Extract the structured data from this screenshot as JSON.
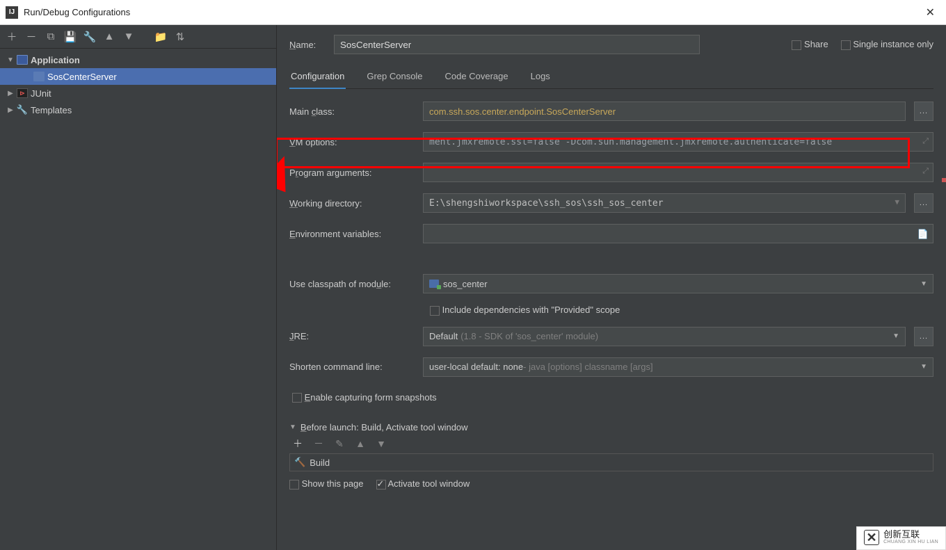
{
  "window": {
    "title": "Run/Debug Configurations"
  },
  "sidebar": {
    "items": [
      {
        "label": "Application",
        "kind": "folder",
        "expanded": true
      },
      {
        "label": "SosCenterServer",
        "kind": "item",
        "selected": true
      },
      {
        "label": "JUnit",
        "kind": "folder",
        "expanded": false
      },
      {
        "label": "Templates",
        "kind": "folder",
        "expanded": false
      }
    ]
  },
  "header": {
    "name_label": "Name:",
    "name_value": "SosCenterServer",
    "share_label": "Share",
    "single_instance_label": "Single instance only"
  },
  "tabs": [
    {
      "label": "Configuration",
      "active": true
    },
    {
      "label": "Grep Console"
    },
    {
      "label": "Code Coverage"
    },
    {
      "label": "Logs"
    }
  ],
  "form": {
    "main_class_label": "Main class:",
    "main_class_value": "com.ssh.sos.center.endpoint.SosCenterServer",
    "vm_options_label": "VM options:",
    "vm_options_value": "ment.jmxremote.ssl=false -Dcom.sun.management.jmxremote.authenticate=false",
    "program_args_label": "Program arguments:",
    "program_args_value": "",
    "working_dir_label": "Working directory:",
    "working_dir_value": "E:\\shengshiworkspace\\ssh_sos\\ssh_sos_center",
    "env_vars_label": "Environment variables:",
    "env_vars_value": "",
    "classpath_label": "Use classpath of module:",
    "classpath_value": "sos_center",
    "include_provided_label": "Include dependencies with \"Provided\" scope",
    "jre_label": "JRE:",
    "jre_value": "Default",
    "jre_hint": "(1.8 - SDK of 'sos_center' module)",
    "shorten_label": "Shorten command line:",
    "shorten_value": "user-local default: none",
    "shorten_hint": " - java [options] classname [args]",
    "enable_capture_label": "Enable capturing form snapshots"
  },
  "before_launch": {
    "header": "Before launch: Build, Activate tool window",
    "build_item": "Build",
    "show_page_label": "Show this page",
    "activate_window_label": "Activate tool window"
  },
  "watermark": {
    "cn": "创新互联",
    "en": "CHUANG XIN HU LIAN"
  }
}
